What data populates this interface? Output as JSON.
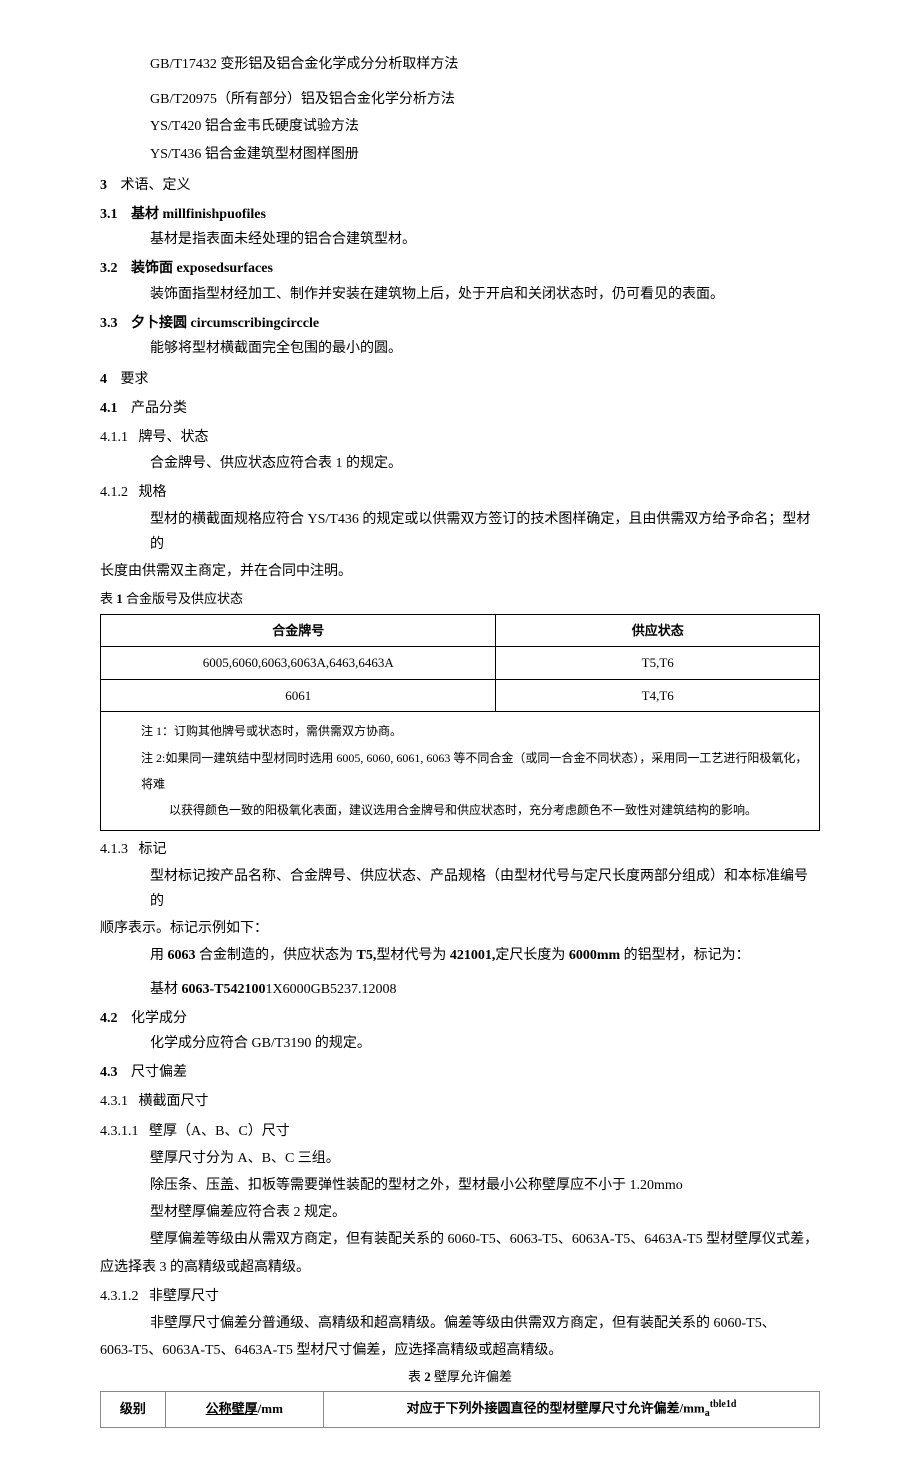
{
  "refs": {
    "r1": "GB/T17432 变形铝及铝合金化学成分分析取样方法",
    "r2": "GB/T20975（所有部分）铝及铝合金化学分析方法",
    "r3": "YS/T420 铝合金韦氏硬度试验方法",
    "r4": "YS/T436 铝合金建筑型材图样图册"
  },
  "s3": {
    "num": "3",
    "title": "术语、定义",
    "s31_num": "3.1",
    "s31_title": "基材 millfinishpuofiles",
    "s31_body": "基材是指表面未经处理的铝合合建筑型材。",
    "s32_num": "3.2",
    "s32_title": "装饰面 exposedsurfaces",
    "s32_body": "装饰面指型材经加工、制作并安装在建筑物上后，处于开启和关闭状态时，仍可看见的表面。",
    "s33_num": "3.3",
    "s33_title": "夕卜接圆 circumscribingcirccle",
    "s33_body": "能够将型材横截面完全包围的最小的圆。"
  },
  "s4": {
    "num": "4",
    "title": "要求",
    "s41_num": "4.1",
    "s41_title": "产品分类",
    "s411_num": "4.1.1",
    "s411_title": "牌号、状态",
    "s411_body": "合金牌号、供应状态应符合表 1 的规定。",
    "s412_num": "4.1.2",
    "s412_title": "规格",
    "s412_body1": "型材的横截面规格应符合 YS/T436 的规定或以供需双方签订的技术图样确定，且由供需双方给予命名；型材的",
    "s412_body2": "长度由供需双主商定，并在合同中注明。",
    "table1_caption_pre": "表 ",
    "table1_caption_num": "1",
    "table1_caption_post": " 合金版号及供应状态",
    "table1": {
      "h1": "合金牌号",
      "h2": "供应状态",
      "r1c1": "6005,6060,6063,6063A,6463,6463A",
      "r1c2": "T5,T6",
      "r2c1": "6061",
      "r2c2": "T4,T6",
      "note1": "注 1：订购其他牌号或状态时，需供需双方协商。",
      "note2": "注 2:如果同一建筑结中型材同时选用 6005, 6060, 6061, 6063 等不同合金（或同一合金不同状态），采用同一工艺进行阳极氧化，将难",
      "note3": "以获得颜色一致的阳极氧化表面，建议选用合金牌号和供应状态时，充分考虑颜色不一致性对建筑结构的影响。"
    },
    "s413_num": "4.1.3",
    "s413_title": "标记",
    "s413_body1": "型材标记按产品名称、合金牌号、供应状态、产品规格（由型材代号与定尺长度两部分组成）和本标准编号的",
    "s413_body2": "顺序表示。标记示例如下：",
    "s413_body3a": "用 ",
    "s413_body3b": "6063",
    "s413_body3c": " 合金制造的，供应状态为 ",
    "s413_body3d": "T5,",
    "s413_body3e": "型材代号为 ",
    "s413_body3f": "421001,",
    "s413_body3g": "定尺长度为 ",
    "s413_body3h": "6000mm",
    "s413_body3i": " 的铝型材，标记为：",
    "s413_body4a": "基材 ",
    "s413_body4b": "6063-T542100",
    "s413_body4c": "1X6000GB5237.12008",
    "s42_num": "4.2",
    "s42_title": "化学成分",
    "s42_body": "化学成分应符合 GB/T3190 的规定。",
    "s43_num": "4.3",
    "s43_title": "尺寸偏差",
    "s431_num": "4.3.1",
    "s431_title": "横截面尺寸",
    "s4311_num": "4.3.1.1",
    "s4311_title": "壁厚（A、B、C）尺寸",
    "s4311_b1": "壁厚尺寸分为 A、B、C 三组。",
    "s4311_b2": "除压条、压盖、扣板等需要弹性装配的型材之外，型材最小公称壁厚应不小于 1.20mmo",
    "s4311_b3": "型材壁厚偏差应符合表 2 规定。",
    "s4311_b4": "壁厚偏差等级由从需双方商定，但有装配关系的 6060-T5、6063-T5、6063A-T5、6463A-T5 型材壁厚仪式差，",
    "s4311_b5": "应选择表 3 的高精级或超高精级。",
    "s4312_num": "4.3.1.2",
    "s4312_title": "非壁厚尺寸",
    "s4312_b1": "非壁厚尺寸偏差分普通级、高精级和超高精级。偏差等级由供需双方商定，但有装配关系的 6060-T5、",
    "s4312_b2": "6063-T5、6063A-T5、6463A-T5 型材尺寸偏差，应选择高精级或超高精级。",
    "table2_caption_pre": "表 ",
    "table2_caption_num": "2",
    "table2_caption_post": " 壁厚允许偏差",
    "table2": {
      "h1": "级别",
      "h2a": "公称壁厚",
      "h2b": "/mm",
      "h3a": "对应于下列外接圆直径的型材壁厚尺寸允许偏差/",
      "h3b": "mm",
      "h3c": "a",
      "h3d": "tble1d"
    }
  }
}
